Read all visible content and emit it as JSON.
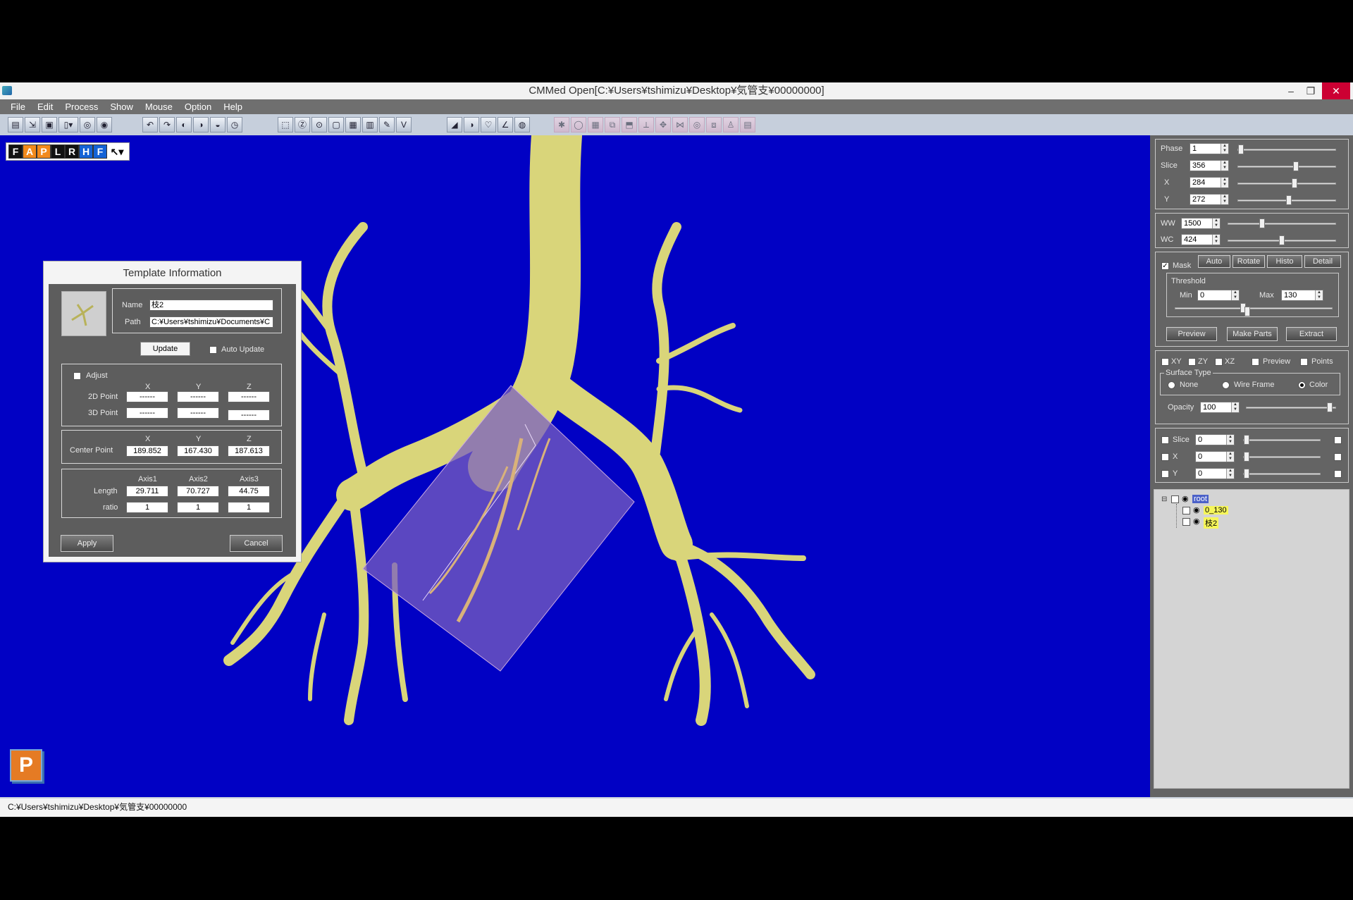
{
  "window": {
    "title": "CMMed  Open[C:¥Users¥tshimizu¥Desktop¥気管支¥00000000]",
    "minimize": "–",
    "restore": "❐",
    "close": "✕"
  },
  "menu": [
    "File",
    "Edit",
    "Process",
    "Show",
    "Mouse",
    "Option",
    "Help"
  ],
  "view_toolbar": {
    "buttons": [
      "F",
      "A",
      "P",
      "L",
      "R",
      "H",
      "F"
    ],
    "cursor": "↖▾"
  },
  "dialog": {
    "title": "Template Information",
    "name_label": "Name",
    "name_value": "枝2",
    "path_label": "Path",
    "path_value": "C:¥Users¥tshimizu¥Documents¥C",
    "update_button": "Update",
    "auto_update_label": "Auto Update",
    "adjust_label": "Adjust",
    "col_x": "X",
    "col_y": "Y",
    "col_z": "Z",
    "point2d_label": "2D Point",
    "point2d": [
      "------",
      "------",
      "------"
    ],
    "point3d_label": "3D Point",
    "point3d": [
      "------",
      "------",
      "------"
    ],
    "center_label": "Center Point",
    "center": [
      "189.852",
      "167.430",
      "187.613"
    ],
    "axis_headers": [
      "Axis1",
      "Axis2",
      "Axis3"
    ],
    "length_label": "Length",
    "length": [
      "29.711",
      "70.727",
      "44.75"
    ],
    "ratio_label": "ratio",
    "ratio": [
      "1",
      "1",
      "1"
    ],
    "apply_button": "Apply",
    "cancel_button": "Cancel"
  },
  "panel": {
    "phase_label": "Phase",
    "phase": "1",
    "slice_label": "Slice",
    "slice": "356",
    "x_label": "X",
    "x": "284",
    "y_label": "Y",
    "y": "272",
    "ww_label": "WW",
    "ww": "1500",
    "wc_label": "WC",
    "wc": "424",
    "mask_label": "Mask",
    "auto_button": "Auto",
    "rotate_button": "Rotate",
    "histo_button": "Histo",
    "detail_button": "Detail",
    "threshold_label": "Threshold",
    "min_label": "Min",
    "min": "0",
    "max_label": "Max",
    "max": "130",
    "preview_button": "Preview",
    "make_parts_button": "Make Parts",
    "extract_button": "Extract",
    "xy_label": "XY",
    "zy_label": "ZY",
    "xz_label": "XZ",
    "preview_label": "Preview",
    "points_label": "Points",
    "surface_type_label": "Surface Type",
    "none_label": "None",
    "wireframe_label": "Wire Frame",
    "color_label": "Color",
    "opacity_label": "Opacity",
    "opacity": "100",
    "slice2_label": "Slice",
    "slice2": "0",
    "x2_label": "X",
    "x2": "0",
    "y2_label": "Y",
    "y2": "0",
    "tree": {
      "root": "root",
      "child1": "0_130",
      "child2": "枝2"
    }
  },
  "statusbar": {
    "path": "C:¥Users¥tshimizu¥Desktop¥気管支¥00000000"
  },
  "logo_letter": "P",
  "colors": {
    "viewport": "#0101c4",
    "airway": "#d9d57a",
    "template_box": "#7a5fc0"
  }
}
